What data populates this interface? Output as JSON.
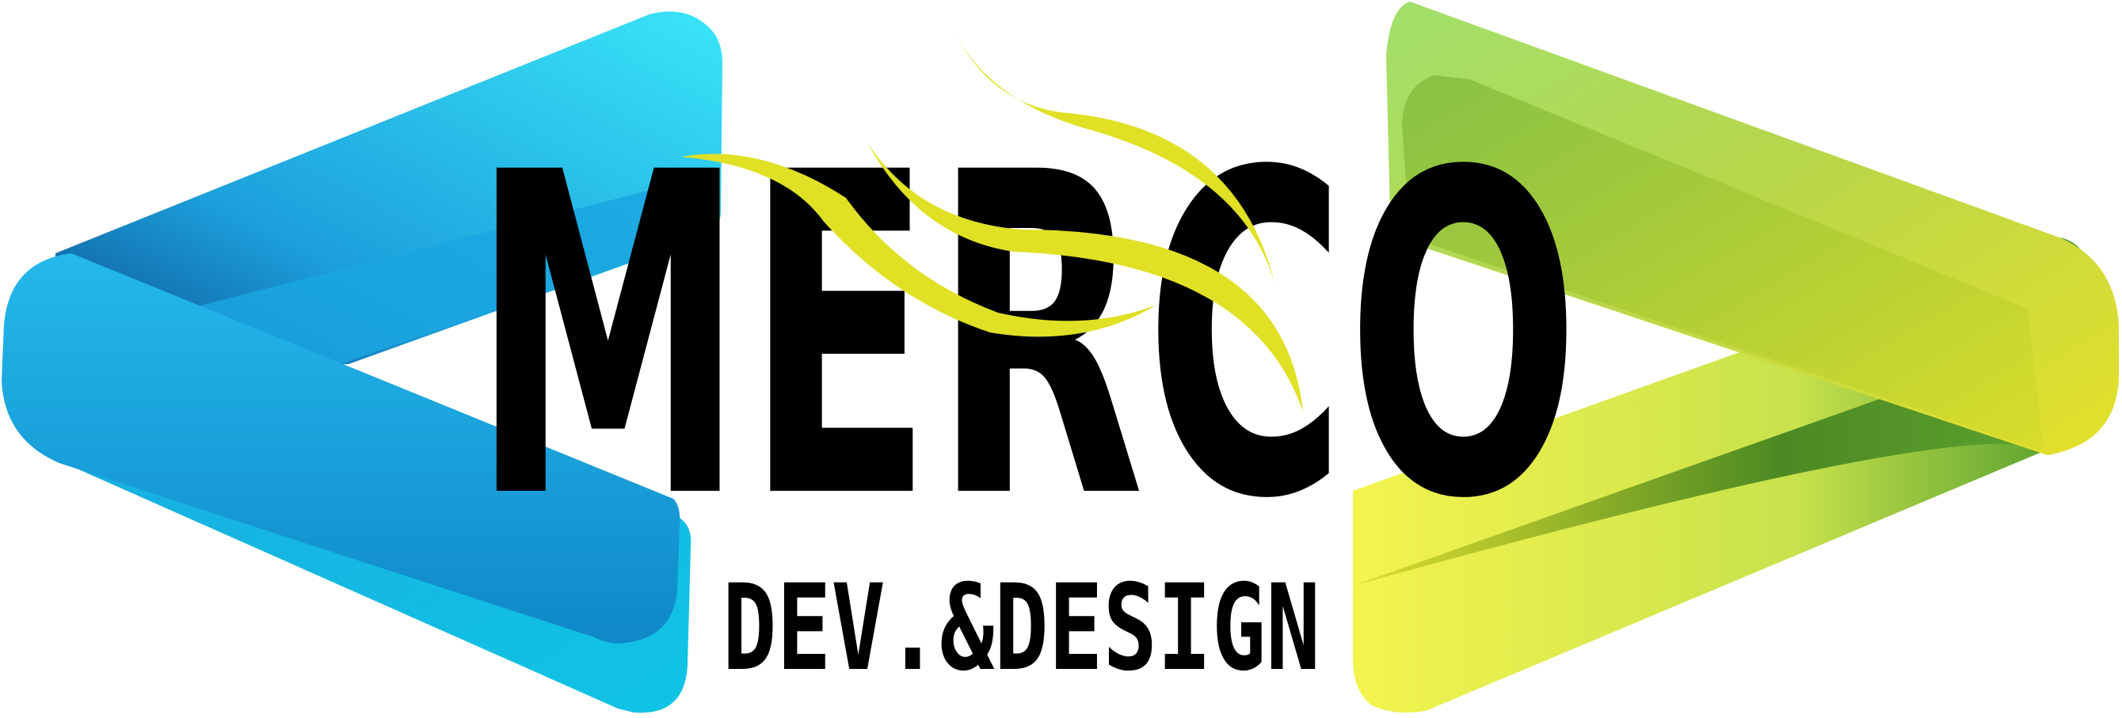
{
  "logo": {
    "wordmark": "MERCO",
    "tagline": "DEV.&DESIGN",
    "left_chevron_icon": "left-chevron-blue",
    "right_chevron_icon": "right-chevron-green-yellow",
    "swoosh_icon": "yellow-swoosh"
  },
  "colors": {
    "text": "#000000",
    "blue_light": "#38E3F7",
    "blue_mid": "#20B8EA",
    "blue_dark": "#0A4D8A",
    "green_light": "#A8E06E",
    "green_mid": "#7DB83A",
    "yellow": "#F2F24B",
    "swoosh": "#E0E024"
  }
}
